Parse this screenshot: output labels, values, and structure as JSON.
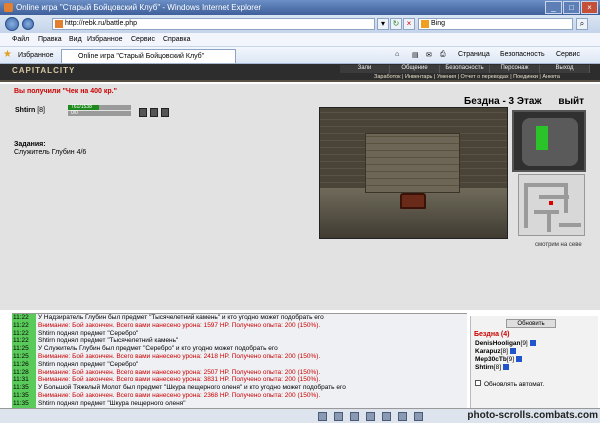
{
  "window": {
    "title": "Online игра \"Старый Бойцовский Клуб\" - Windows Internet Explorer"
  },
  "address": {
    "url": "http://rebk.ru/battle.php",
    "search_engine": "Bing"
  },
  "menu": [
    "Файл",
    "Правка",
    "Вид",
    "Избранное",
    "Сервис",
    "Справка"
  ],
  "favorites": {
    "label": "Избранное",
    "tab": "Online игра \"Старый Бойцовский Клуб\""
  },
  "toolbar": [
    "Страница",
    "Безопасность",
    "Сервис"
  ],
  "game": {
    "logo": "CAPITALCITY",
    "nav": [
      "Зали",
      "Общение",
      "Безопасность",
      "Персонаж",
      "Выход"
    ],
    "subnav": "Заработок | Инвентарь | Умения | Отчет о переводах | Поединки | Анкета",
    "message": "Вы получили \"Чек на 400 кр.\"",
    "hero": {
      "name": "Shtirn",
      "level": "[8]",
      "hp": "761/1538",
      "mp": "0/0",
      "hp_fraction": 0.49
    },
    "tasks_title": "Задания:",
    "task": "Служитель Глубин 4/6",
    "location": "Бездна - 3 Этаж",
    "location_exit": "выйт",
    "look_hint": "смотрим на севе"
  },
  "chat": [
    {
      "time": "11:22",
      "text": "У Надзиратель Глубин был предмет \"Тысячелетний камень\" и кто угодно может подобрать его",
      "warn": false
    },
    {
      "time": "11:22",
      "text": "Внимание: Бой закончен. Всего вами нанесено урона: 1597 HP. Получено опыта: 200 (150%).",
      "warn": true
    },
    {
      "time": "11:22",
      "text": "Shtirn поднял предмет \"Серебро\"",
      "warn": false
    },
    {
      "time": "11:22",
      "text": "Shtirn поднял предмет \"Тысячелетний камень\"",
      "warn": false
    },
    {
      "time": "11:25",
      "text": "У Служитель Глубин был предмет \"Серебро\" и кто угодно может подобрать его",
      "warn": false
    },
    {
      "time": "11:25",
      "text": "Внимание: Бой закончен. Всего вами нанесено урона: 2418 HP. Получено опыта: 200 (150%).",
      "warn": true
    },
    {
      "time": "11:26",
      "text": "Shtirn поднял предмет \"Серебро\"",
      "warn": false
    },
    {
      "time": "11:28",
      "text": "Внимание: Бой закончен. Всего вами нанесено урона: 2507 HP. Получено опыта: 200 (150%).",
      "warn": true
    },
    {
      "time": "11:31",
      "text": "Внимание: Бой закончен. Всего вами нанесено урона: 3831 HP. Получено опыта: 200 (150%).",
      "warn": true
    },
    {
      "time": "11:35",
      "text": "У Большой Тяжелый Молот был предмет \"Шкура пещерного оленя\" и кто угодно может подобрать его",
      "warn": false
    },
    {
      "time": "11:35",
      "text": "Внимание: Бой закончен. Всего вами нанесено урона: 2368 HP. Получено опыта: 200 (150%).",
      "warn": true
    },
    {
      "time": "11:35",
      "text": "Shtirn поднял предмет \"Шкура пещерного оленя\"",
      "warn": false
    }
  ],
  "room": {
    "refresh": "Обновить",
    "title": "Бездна (4)",
    "players": [
      {
        "name": "DenisHooligan",
        "level": "[9]"
      },
      {
        "name": "Karapuz",
        "level": "[8]"
      },
      {
        "name": "Mep30cTb",
        "level": "[9]"
      },
      {
        "name": "Shtirn",
        "level": "[8]"
      }
    ],
    "auto_label": "Обновлять автомат."
  },
  "watermark": "photo-scrolls.combats.com",
  "colors": {
    "chat_time_bg": "#5acb5a",
    "warning": "#cc0000",
    "hp": "#1c8a1c"
  }
}
